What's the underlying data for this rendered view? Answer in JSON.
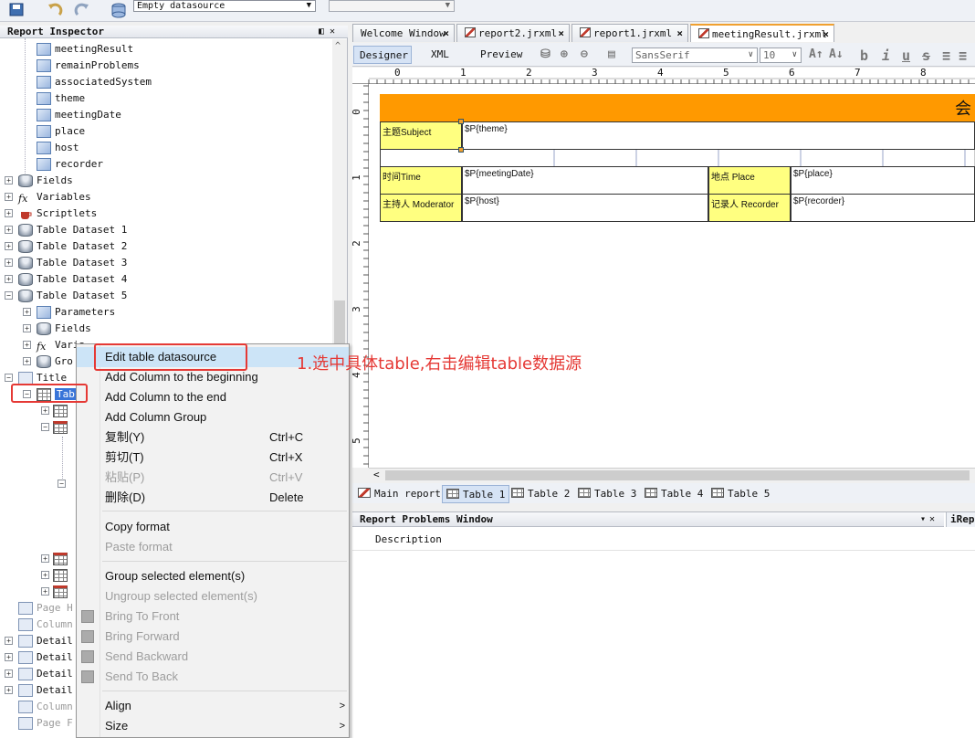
{
  "toolbar": {
    "datasource": "Empty datasource",
    "icons": [
      "save-icon",
      "undo-icon",
      "redo-icon",
      "datasource-icon"
    ]
  },
  "inspector": {
    "title": "Report Inspector",
    "params": [
      "meetingResult",
      "remainProblems",
      "associatedSystem",
      "theme",
      "meetingDate",
      "place",
      "host",
      "recorder"
    ],
    "sections": [
      "Fields",
      "Variables",
      "Scriptlets",
      "Table Dataset 1",
      "Table Dataset 2",
      "Table Dataset 3",
      "Table Dataset 4",
      "Table Dataset 5"
    ],
    "ds5_children": [
      "Parameters",
      "Fields",
      "Varia",
      "Gro"
    ],
    "title_band": "Title",
    "table_node": "Tab",
    "lower_bands": [
      "Page H",
      "Column",
      "Detail",
      "Detail",
      "Detail",
      "Detail",
      "Column",
      "Page F"
    ]
  },
  "tabs": [
    {
      "label": "Welcome Window"
    },
    {
      "label": "report2.jrxml"
    },
    {
      "label": "report1.jrxml"
    },
    {
      "label": "meetingResult.jrxml"
    }
  ],
  "designer": {
    "modes": [
      "Designer",
      "XML",
      "Preview"
    ],
    "font": "SansSerif",
    "size": "10",
    "ruler_h": [
      "0",
      "1",
      "2",
      "3",
      "4",
      "5",
      "6",
      "7",
      "8"
    ],
    "ruler_v": [
      "0",
      "1",
      "2",
      "3",
      "4",
      "5"
    ]
  },
  "canvas": {
    "title_char": "会",
    "subject_label": "主题Subject",
    "theme_expr": "$P{theme}",
    "time_label": "时间Time",
    "date_expr": "$P{meetingDate}",
    "place_label": "地点 Place",
    "place_expr": "$P{place}",
    "moderator_label": "主持人 Moderator",
    "host_expr": "$P{host}",
    "recorder_label": "记录人 Recorder",
    "recorder_expr": "$P{recorder}"
  },
  "sheet_tabs": [
    "Main report",
    "Table 1",
    "Table 2",
    "Table 3",
    "Table 4",
    "Table 5"
  ],
  "problems": {
    "title": "Report Problems Window",
    "column": "Description",
    "side_tab": "iRep"
  },
  "menu": {
    "edit_ds": "Edit table datasource",
    "add_col_begin": "Add Column to the beginning",
    "add_col_end": "Add Column to the end",
    "add_col_group": "Add Column Group",
    "copy": "复制(Y)",
    "copy_sc": "Ctrl+C",
    "cut": "剪切(T)",
    "cut_sc": "Ctrl+X",
    "paste": "粘贴(P)",
    "paste_sc": "Ctrl+V",
    "delete": "删除(D)",
    "delete_sc": "Delete",
    "copy_format": "Copy format",
    "paste_format": "Paste format",
    "group": "Group selected element(s)",
    "ungroup": "Ungroup selected element(s)",
    "bring_front": "Bring To Front",
    "bring_forward": "Bring Forward",
    "send_backward": "Send Backward",
    "send_back": "Send To Back",
    "align": "Align",
    "size": "Size"
  },
  "annotation": "1.选中具体table,右击编辑table数据源",
  "colors": {
    "accent": "#f0a030",
    "title_band": "#ff9900",
    "label_cell": "#ffff80",
    "highlight": "#e53935"
  }
}
